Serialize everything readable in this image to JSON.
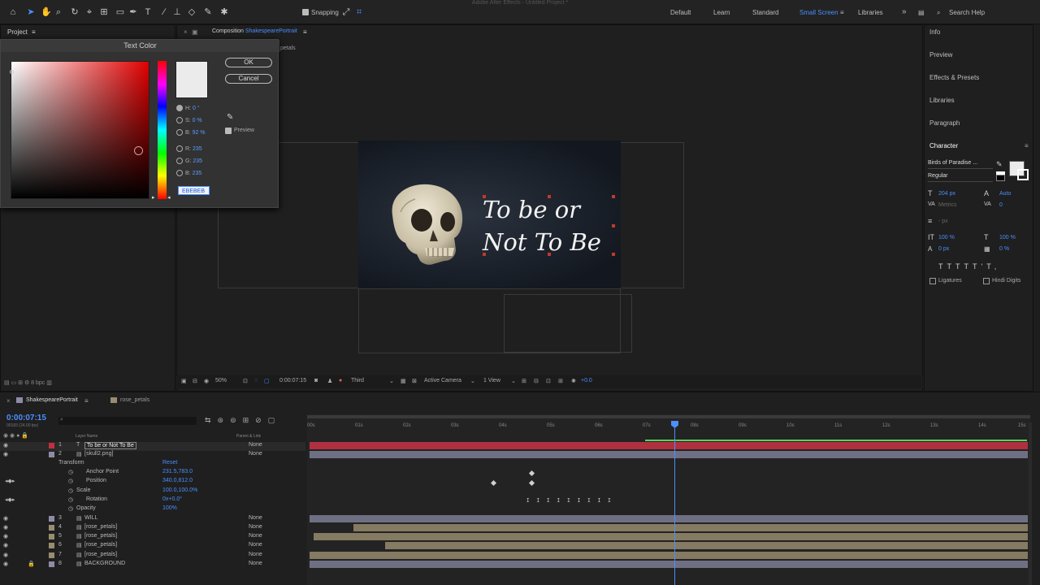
{
  "app_title": "Adobe After Effects - Untitled Project *",
  "toolbar": {
    "snapping_label": "Snapping",
    "workspaces": [
      "Default",
      "Learn",
      "Standard",
      "Small Screen",
      "Libraries"
    ],
    "active_workspace": "Small Screen",
    "search_placeholder": "Search Help"
  },
  "project_panel": {
    "title": "Project",
    "bpc": "8 bpc"
  },
  "dialog": {
    "title": "Text Color",
    "ok": "OK",
    "cancel": "Cancel",
    "preview_label": "Preview",
    "fields": [
      {
        "label": "H:",
        "value": "0 °"
      },
      {
        "label": "S:",
        "value": "0 %"
      },
      {
        "label": "B:",
        "value": "92 %"
      },
      {
        "label": "R:",
        "value": "235"
      },
      {
        "label": "G:",
        "value": "235"
      },
      {
        "label": "B:",
        "value": "235"
      }
    ],
    "hex": "EBEBEB",
    "swatch_color": "#ebebeb"
  },
  "composition": {
    "panel_label": "Composition",
    "name": "ShakespearePortrait",
    "subtab": "petals",
    "text_line1": "To be or",
    "text_line2": "Not To Be"
  },
  "viewer_bar": {
    "zoom": "50%",
    "timecode": "0:00:07:15",
    "resolution": "Third",
    "camera": "Active Camera",
    "views": "1 View",
    "exposure": "+0.0"
  },
  "right_panels": {
    "items": [
      "Info",
      "Preview",
      "Effects & Presets",
      "Libraries",
      "Paragraph"
    ],
    "character_title": "Character",
    "font": "Birds of Paradise ...",
    "style": "Regular",
    "size": "204 px",
    "leading": "Auto",
    "kerning": "Metrics",
    "tracking": "0",
    "stroke": "- px",
    "vscale": "100 %",
    "hscale": "100 %",
    "baseline": "0 px",
    "tsume": "0 %",
    "ligatures": "Ligatures",
    "hindi_digits": "Hindi Digits"
  },
  "timeline": {
    "tabs": [
      "ShakespearePortrait",
      "rose_petals"
    ],
    "current_time": "0:00:07:15",
    "frames": "00183 (24.00 fps)",
    "col_layer_name": "Layer Name",
    "col_parent": "Parent & Link",
    "ruler": [
      "00s",
      "01s",
      "02s",
      "03s",
      "04s",
      "05s",
      "06s",
      "07s",
      "08s",
      "09s",
      "10s",
      "11s",
      "12s",
      "13s",
      "14s",
      "15s"
    ],
    "layers": [
      {
        "num": "1",
        "name": "To be or Not To Be",
        "parent": "None",
        "color": "#c03040"
      },
      {
        "num": "2",
        "name": "[skull2.png]",
        "parent": "None",
        "color": "#8c8ca8"
      },
      {
        "num": "3",
        "name": "WILL",
        "parent": "None",
        "color": "#8c8ca8"
      },
      {
        "num": "4",
        "name": "[rose_petals]",
        "parent": "None",
        "color": "#9a8c70"
      },
      {
        "num": "5",
        "name": "[rose_petals]",
        "parent": "None",
        "color": "#9a8c70"
      },
      {
        "num": "6",
        "name": "[rose_petals]",
        "parent": "None",
        "color": "#9a8c70"
      },
      {
        "num": "7",
        "name": "[rose_petals]",
        "parent": "None",
        "color": "#9a8c70"
      },
      {
        "num": "8",
        "name": "BACKGROUND",
        "parent": "None",
        "color": "#8c8ca8"
      }
    ],
    "transform": {
      "label": "Transform",
      "reset": "Reset",
      "props": [
        {
          "name": "Anchor Point",
          "value": "231.5,783.0"
        },
        {
          "name": "Position",
          "value": "340.0,812.0"
        },
        {
          "name": "Scale",
          "value": "100.0,100.0%"
        },
        {
          "name": "Rotation",
          "value": "0x+0.0°"
        },
        {
          "name": "Opacity",
          "value": "100%"
        }
      ]
    }
  }
}
